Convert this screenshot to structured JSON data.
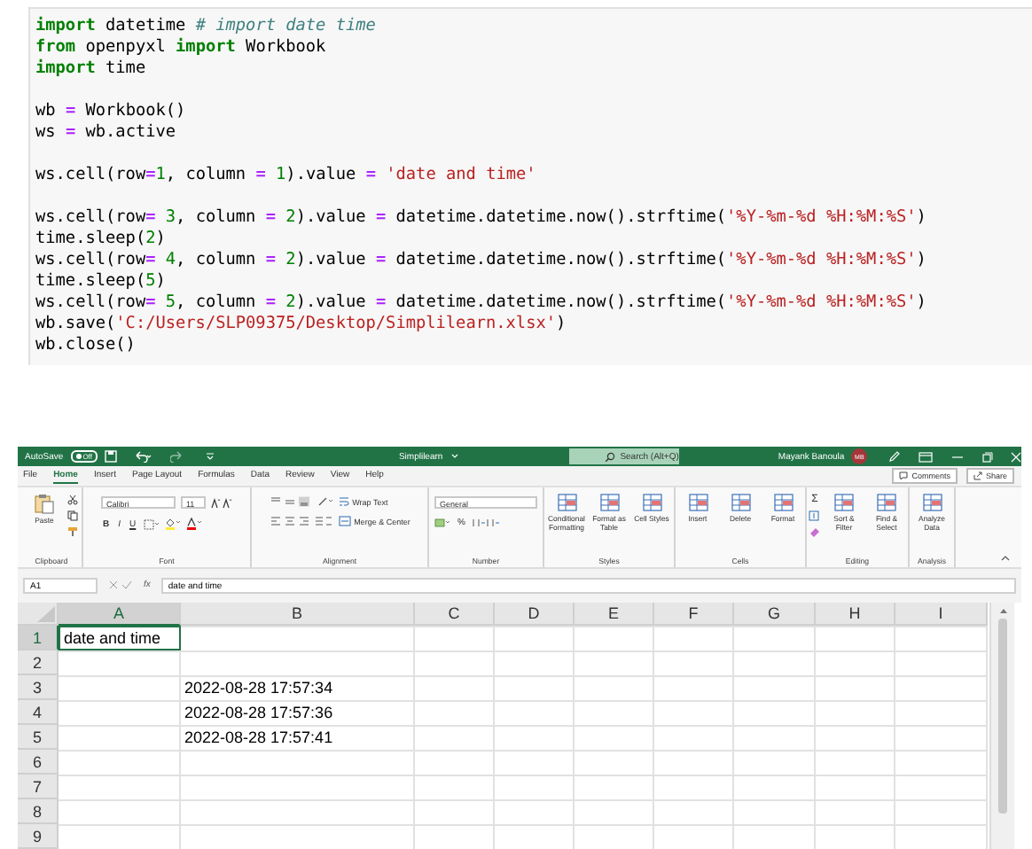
{
  "code_cell": {
    "blocks": [
      [
        [
          {
            "kind": "keyword",
            "text": "import"
          },
          {
            "kind": "plain",
            "text": " datetime "
          },
          {
            "kind": "comment",
            "text": "# import date time"
          }
        ],
        [
          {
            "kind": "keyword",
            "text": "from"
          },
          {
            "kind": "plain",
            "text": " openpyxl "
          },
          {
            "kind": "keyword",
            "text": "import"
          },
          {
            "kind": "plain",
            "text": " Workbook"
          }
        ],
        [
          {
            "kind": "keyword",
            "text": "import"
          },
          {
            "kind": "plain",
            "text": " time"
          }
        ]
      ],
      [
        [
          {
            "kind": "plain",
            "text": "wb "
          },
          {
            "kind": "operator",
            "text": "="
          },
          {
            "kind": "plain",
            "text": " Workbook()"
          }
        ],
        [
          {
            "kind": "plain",
            "text": "ws "
          },
          {
            "kind": "operator",
            "text": "="
          },
          {
            "kind": "plain",
            "text": " wb.active"
          }
        ]
      ],
      [
        [
          {
            "kind": "plain",
            "text": "ws.cell(row"
          },
          {
            "kind": "operator",
            "text": "="
          },
          {
            "kind": "number",
            "text": "1"
          },
          {
            "kind": "plain",
            "text": ", column "
          },
          {
            "kind": "operator",
            "text": "="
          },
          {
            "kind": "number",
            "text": " 1"
          },
          {
            "kind": "plain",
            "text": ").value "
          },
          {
            "kind": "operator",
            "text": "="
          },
          {
            "kind": "string",
            "text": " 'date and time'"
          }
        ]
      ],
      [
        [
          {
            "kind": "plain",
            "text": "ws.cell(row"
          },
          {
            "kind": "operator",
            "text": "="
          },
          {
            "kind": "number",
            "text": " 3"
          },
          {
            "kind": "plain",
            "text": ", column "
          },
          {
            "kind": "operator",
            "text": "="
          },
          {
            "kind": "number",
            "text": " 2"
          },
          {
            "kind": "plain",
            "text": ").value "
          },
          {
            "kind": "operator",
            "text": "="
          },
          {
            "kind": "plain",
            "text": " datetime.datetime.now().strftime("
          },
          {
            "kind": "string",
            "text": "'%Y-%m-%d %H:%M:%S'"
          },
          {
            "kind": "plain",
            "text": ")"
          }
        ],
        [
          {
            "kind": "plain",
            "text": "time.sleep("
          },
          {
            "kind": "number",
            "text": "2"
          },
          {
            "kind": "plain",
            "text": ")"
          }
        ],
        [
          {
            "kind": "plain",
            "text": "ws.cell(row"
          },
          {
            "kind": "operator",
            "text": "="
          },
          {
            "kind": "number",
            "text": " 4"
          },
          {
            "kind": "plain",
            "text": ", column "
          },
          {
            "kind": "operator",
            "text": "="
          },
          {
            "kind": "number",
            "text": " 2"
          },
          {
            "kind": "plain",
            "text": ").value "
          },
          {
            "kind": "operator",
            "text": "="
          },
          {
            "kind": "plain",
            "text": " datetime.datetime.now().strftime("
          },
          {
            "kind": "string",
            "text": "'%Y-%m-%d %H:%M:%S'"
          },
          {
            "kind": "plain",
            "text": ")"
          }
        ],
        [
          {
            "kind": "plain",
            "text": "time.sleep("
          },
          {
            "kind": "number",
            "text": "5"
          },
          {
            "kind": "plain",
            "text": ")"
          }
        ],
        [
          {
            "kind": "plain",
            "text": "ws.cell(row"
          },
          {
            "kind": "operator",
            "text": "="
          },
          {
            "kind": "number",
            "text": " 5"
          },
          {
            "kind": "plain",
            "text": ", column "
          },
          {
            "kind": "operator",
            "text": "="
          },
          {
            "kind": "number",
            "text": " 2"
          },
          {
            "kind": "plain",
            "text": ").value "
          },
          {
            "kind": "operator",
            "text": "="
          },
          {
            "kind": "plain",
            "text": " datetime.datetime.now().strftime("
          },
          {
            "kind": "string",
            "text": "'%Y-%m-%d %H:%M:%S'"
          },
          {
            "kind": "plain",
            "text": ")"
          }
        ],
        [
          {
            "kind": "plain",
            "text": "wb.save("
          },
          {
            "kind": "string",
            "text": "'C:/Users/SLP09375/Desktop/Simplilearn.xlsx'"
          },
          {
            "kind": "plain",
            "text": ")"
          }
        ],
        [
          {
            "kind": "plain",
            "text": "wb.close()"
          }
        ]
      ]
    ]
  },
  "excel": {
    "title_bar": {
      "autosave_label": "AutoSave",
      "autosave_state": "Off",
      "autosave_on": false,
      "file_name": "Simplilearn",
      "search_placeholder": "Search (Alt+Q)",
      "user_name": "Mayank Banoula",
      "user_initials": "MB"
    },
    "tabs": [
      {
        "label": "File",
        "selected": false
      },
      {
        "label": "Home",
        "selected": true
      },
      {
        "label": "Insert",
        "selected": false
      },
      {
        "label": "Page Layout",
        "selected": false
      },
      {
        "label": "Formulas",
        "selected": false
      },
      {
        "label": "Data",
        "selected": false
      },
      {
        "label": "Review",
        "selected": false
      },
      {
        "label": "View",
        "selected": false
      },
      {
        "label": "Help",
        "selected": false
      }
    ],
    "comments_button": "Comments",
    "share_button": "Share",
    "ribbon_groups": [
      {
        "kind": "clipboard",
        "label": "Clipboard",
        "buttons": [
          "Paste"
        ]
      },
      {
        "kind": "font",
        "label": "Font",
        "font_name": "Calibri",
        "font_size": "11",
        "buttons": [
          "B",
          "I",
          "U"
        ]
      },
      {
        "kind": "alignment",
        "label": "Alignment",
        "buttons": [
          "Wrap Text",
          "Merge & Center"
        ]
      },
      {
        "kind": "number",
        "label": "Number",
        "format": "General",
        "buttons": [
          "%"
        ]
      },
      {
        "kind": "large",
        "label": "Styles",
        "buttons": [
          "Conditional Formatting",
          "Format as Table",
          "Cell Styles"
        ]
      },
      {
        "kind": "large",
        "label": "Cells",
        "buttons": [
          "Insert",
          "Delete",
          "Format"
        ]
      },
      {
        "kind": "editing",
        "label": "Editing",
        "autosum_symbol": "Σ",
        "buttons": [
          "Sort & Filter",
          "Find & Select"
        ]
      },
      {
        "kind": "large",
        "label": "Analysis",
        "buttons": [
          "Analyze Data"
        ]
      }
    ],
    "formula_bar": {
      "name_box": "A1",
      "fx": "fx",
      "value": "date and time"
    },
    "columns": [
      {
        "label": "A",
        "selected": true
      },
      {
        "label": "B",
        "selected": false
      },
      {
        "label": "C",
        "selected": false
      },
      {
        "label": "D",
        "selected": false
      },
      {
        "label": "E",
        "selected": false
      },
      {
        "label": "F",
        "selected": false
      },
      {
        "label": "G",
        "selected": false
      },
      {
        "label": "H",
        "selected": false
      },
      {
        "label": "I",
        "selected": false
      }
    ],
    "rows": [
      {
        "label": "1",
        "selected": true,
        "column_a": "date and time"
      },
      {
        "label": "2",
        "selected": false
      },
      {
        "label": "3",
        "selected": false,
        "column_b": "2022-08-28 17:57:34"
      },
      {
        "label": "4",
        "selected": false,
        "column_b": "2022-08-28 17:57:36"
      },
      {
        "label": "5",
        "selected": false,
        "column_b": "2022-08-28 17:57:41"
      },
      {
        "label": "6",
        "selected": false
      },
      {
        "label": "7",
        "selected": false
      },
      {
        "label": "8",
        "selected": false
      },
      {
        "label": "9",
        "selected": false
      }
    ]
  }
}
